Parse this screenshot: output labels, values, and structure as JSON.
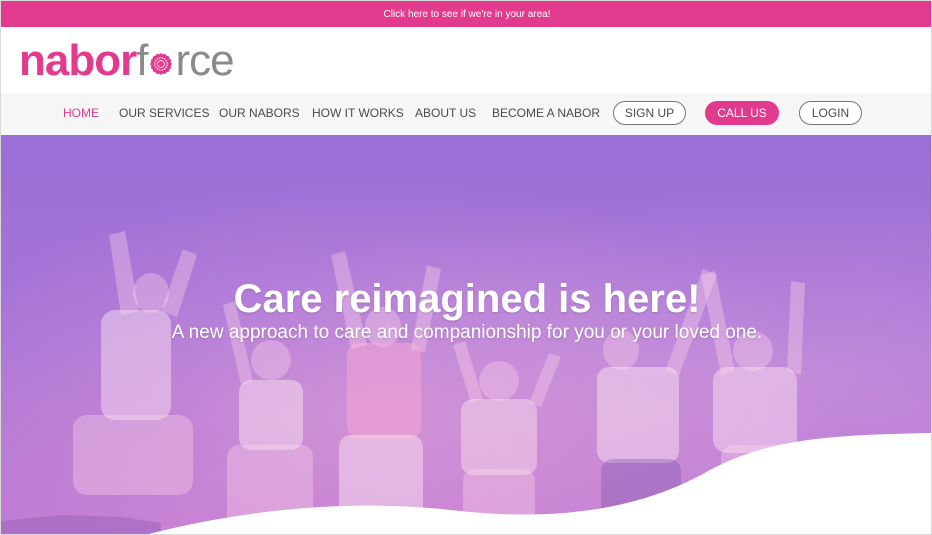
{
  "announcement": {
    "text": "Click here to see if we're in your area!"
  },
  "brand": {
    "part1": "nabor",
    "part2a": "f",
    "part2b": "rce"
  },
  "colors": {
    "accent": "#e23b8e",
    "nav_bg": "#f6f6f6",
    "hero": "#a774d8"
  },
  "nav": {
    "items": [
      {
        "label": "HOME",
        "active": true
      },
      {
        "label": "OUR SERVICES"
      },
      {
        "label": "OUR NABORS"
      },
      {
        "label": "HOW IT WORKS"
      },
      {
        "label": "ABOUT US"
      },
      {
        "label": "BECOME A NABOR"
      }
    ],
    "signup": "SIGN UP",
    "call": "CALL US",
    "login": "LOGIN"
  },
  "hero": {
    "title": "Care reimagined is here!",
    "subtitle": "A new approach to care and companionship for you or your loved one."
  }
}
